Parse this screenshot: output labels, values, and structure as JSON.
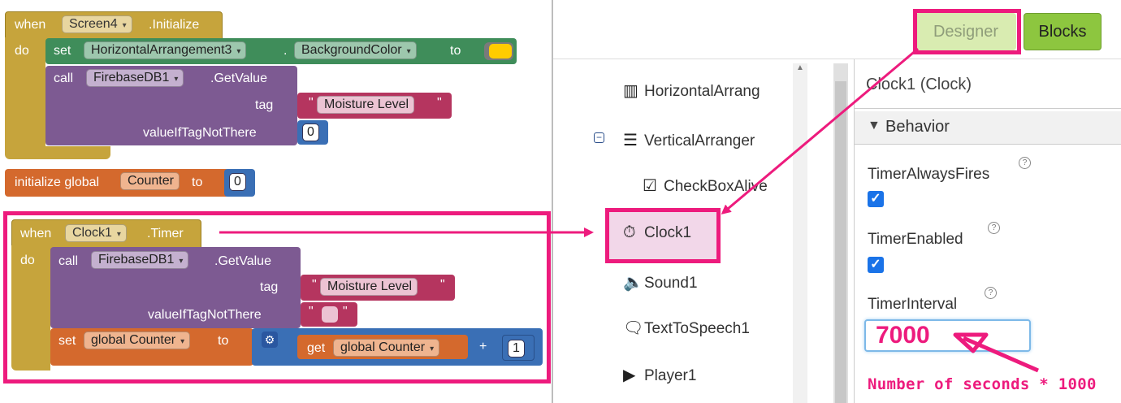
{
  "blocks": {
    "screen_init": {
      "when": "when",
      "component": "Screen4",
      "event": ".Initialize",
      "do": "do",
      "set": {
        "kw": "set",
        "component": "HorizontalArrangement3",
        "dot": ".",
        "property": "BackgroundColor",
        "to": "to"
      },
      "call": {
        "kw": "call",
        "component": "FirebaseDB1",
        "method": ".GetValue",
        "tag_label": "tag",
        "tag_value": "Moisture Level",
        "default_label": "valueIfTagNotThere",
        "default_value": "0"
      }
    },
    "global_init": {
      "label": "initialize global",
      "name": "Counter",
      "to": "to",
      "value": "0"
    },
    "clock_timer": {
      "when": "when",
      "component": "Clock1",
      "event": ".Timer",
      "do": "do",
      "call": {
        "kw": "call",
        "component": "FirebaseDB1",
        "method": ".GetValue",
        "tag_label": "tag",
        "tag_value": "Moisture Level",
        "default_label": "valueIfTagNotThere"
      },
      "set": {
        "kw": "set",
        "variable": "global Counter",
        "to": "to",
        "get_kw": "get",
        "get_variable": "global Counter",
        "op": "+",
        "addend": "1"
      }
    }
  },
  "designer": {
    "buttons": {
      "designer": "Designer",
      "blocks": "Blocks"
    },
    "tree": [
      {
        "icon": "horizontal-arrangement-icon",
        "label": "HorizontalArrang"
      },
      {
        "icon": "vertical-arrangement-icon",
        "label": "VerticalArranger"
      },
      {
        "icon": "checkbox-icon",
        "label": "CheckBoxAlive"
      },
      {
        "icon": "clock-icon",
        "label": "Clock1"
      },
      {
        "icon": "sound-icon",
        "label": "Sound1"
      },
      {
        "icon": "text-to-speech-icon",
        "label": "TextToSpeech1"
      },
      {
        "icon": "player-icon",
        "label": "Player1"
      }
    ],
    "properties": {
      "component_title": "Clock1 (Clock)",
      "section": "Behavior",
      "timer_always_fires": "TimerAlwaysFires",
      "timer_enabled": "TimerEnabled",
      "timer_interval": "TimerInterval",
      "timer_interval_value": "7000",
      "help_mark": "?"
    },
    "annotation": "Number of seconds * 1000"
  },
  "colors": {
    "highlight": "#ed1b7d",
    "event_block": "#c6a43c",
    "set_block": "#3f8d5a",
    "call_block": "#7d5a92",
    "text_block": "#b5355f",
    "math_block": "#3a6fb5",
    "variable_block": "#d4692d",
    "blocks_button": "#8dc63f"
  }
}
